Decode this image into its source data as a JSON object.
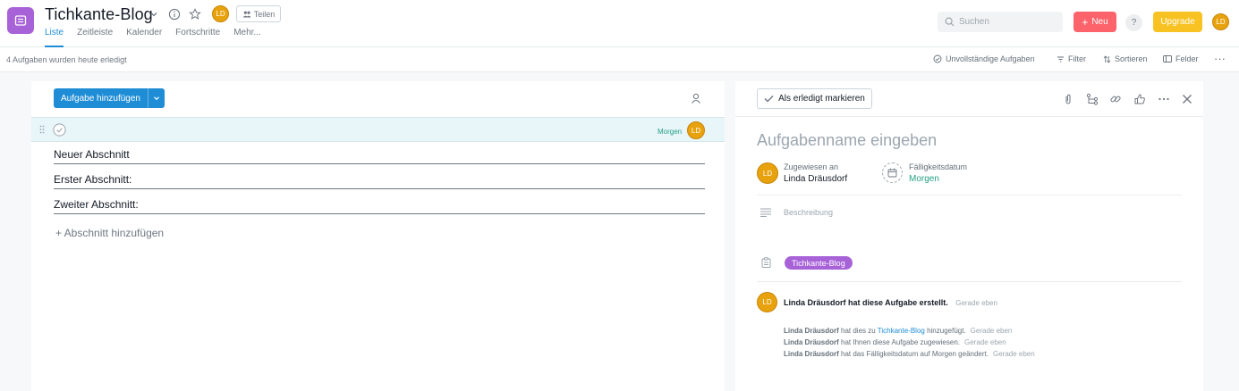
{
  "header": {
    "project_title": "Tichkante-Blog",
    "avatar_initials": "LD",
    "share_label": "Teilen",
    "tabs": [
      {
        "label": "Liste",
        "active": true
      },
      {
        "label": "Zeitleiste",
        "active": false
      },
      {
        "label": "Kalender",
        "active": false
      },
      {
        "label": "Fortschritte",
        "active": false
      },
      {
        "label": "Mehr...",
        "active": false
      }
    ],
    "search_placeholder": "Suchen",
    "new_label": "Neu",
    "help_label": "?",
    "upgrade_label": "Upgrade",
    "user_initials": "LD"
  },
  "subbar": {
    "completed_note": "4 Aufgaben wurden heute erledigt",
    "incomplete_label": "Unvollständige Aufgaben",
    "filter_label": "Filter",
    "sort_label": "Sortieren",
    "fields_label": "Felder",
    "more_label": "···"
  },
  "list": {
    "add_task_label": "Aufgabe hinzufügen",
    "task_row": {
      "due": "Morgen",
      "assignee_initials": "LD"
    },
    "sections": [
      "Neuer Abschnitt",
      "Erster Abschnitt:",
      "Zweiter Abschnitt:"
    ],
    "add_section_label": "+ Abschnitt hinzufügen"
  },
  "detail": {
    "mark_done_label": "Als erledigt markieren",
    "task_name_placeholder": "Aufgabenname eingeben",
    "assignee_label": "Zugewiesen an",
    "assignee_name": "Linda Dräusdorf",
    "assignee_initials": "LD",
    "due_label": "Fälligkeitsdatum",
    "due_value": "Morgen",
    "description_placeholder": "Beschreibung",
    "project_tag": "Tichkante-Blog",
    "activity_main": "Linda Dräusdorf hat diese Aufgabe erstellt.",
    "activity_main_time": "Gerade eben",
    "activity": [
      {
        "actor": "Linda Dräusdorf",
        "pre": " hat dies zu ",
        "link": "Tichkante-Blog",
        "post": " hinzugefügt.",
        "time": "Gerade eben"
      },
      {
        "actor": "Linda Dräusdorf",
        "pre": " hat Ihnen diese Aufgabe zugewiesen.",
        "link": "",
        "post": "",
        "time": "Gerade eben"
      },
      {
        "actor": "Linda Dräusdorf",
        "pre": " hat das Fälligkeitsdatum auf Morgen geändert.",
        "link": "",
        "post": "",
        "time": "Gerade eben"
      }
    ]
  },
  "colors": {
    "project_purple": "#a862d8",
    "primary_blue": "#1f8dd6",
    "new_red": "#fc636b",
    "upgrade_yellow": "#f8c223",
    "avatar_orange": "#e8a20d",
    "due_green": "#25a085"
  }
}
